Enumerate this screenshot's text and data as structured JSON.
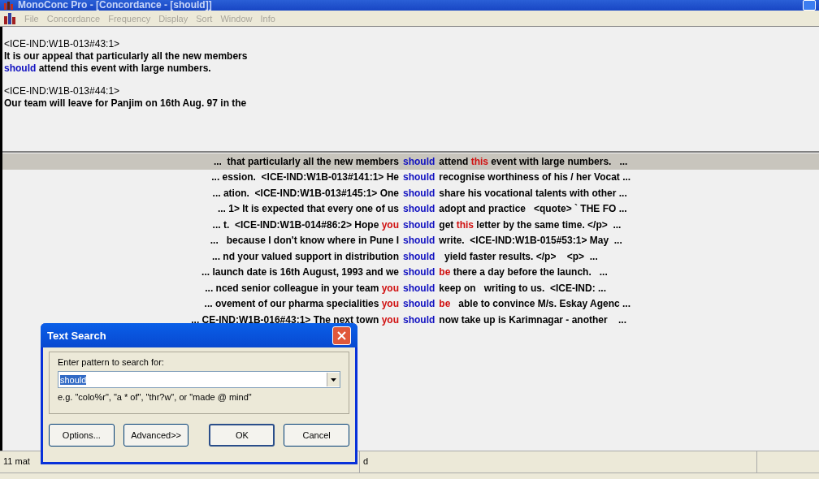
{
  "window": {
    "title": "MonoConc Pro - [Concordance - [should]]"
  },
  "menu": [
    "File",
    "Concordance",
    "Frequency",
    "Display",
    "Sort",
    "Window",
    "Info"
  ],
  "preview": [
    {
      "ref": "<ICE-IND:W1B-013#43:1>",
      "lines": [
        [
          {
            "text": "It is our appeal that particularly all the new members",
            "kind": "plain"
          }
        ],
        [
          {
            "text": "should",
            "kind": "node"
          },
          {
            "text": " attend this event with large numbers.",
            "kind": "plain"
          }
        ]
      ]
    },
    {
      "ref": "<ICE-IND:W1B-013#44:1>",
      "lines": [
        [
          {
            "text": "Our team will leave for Panjim on 16th Aug. 97 in the",
            "kind": "plain"
          }
        ]
      ]
    }
  ],
  "concordance": [
    {
      "selected": true,
      "left": [
        {
          "text": "...  that particularly all the new members",
          "kind": "plain"
        }
      ],
      "node": "should",
      "right": [
        {
          "text": "attend ",
          "kind": "plain"
        },
        {
          "text": "this",
          "kind": "collocate"
        },
        {
          "text": " event with large numbers.   ...",
          "kind": "plain"
        }
      ]
    },
    {
      "selected": false,
      "left": [
        {
          "text": "... ession.  <ICE-IND:W1B-013#141:1> He",
          "kind": "plain"
        }
      ],
      "node": "should",
      "right": [
        {
          "text": "recognise worthiness of his / her Vocat ...",
          "kind": "plain"
        }
      ]
    },
    {
      "selected": false,
      "left": [
        {
          "text": "... ation.  <ICE-IND:W1B-013#145:1> One",
          "kind": "plain"
        }
      ],
      "node": "should",
      "right": [
        {
          "text": "share his vocational talents with other ...",
          "kind": "plain"
        }
      ]
    },
    {
      "selected": false,
      "left": [
        {
          "text": "... 1> It is expected that every one of us",
          "kind": "plain"
        }
      ],
      "node": "should",
      "right": [
        {
          "text": "adopt and practice   <quote> ` THE FO ...",
          "kind": "plain"
        }
      ]
    },
    {
      "selected": false,
      "left": [
        {
          "text": "... t.  <ICE-IND:W1B-014#86:2> Hope ",
          "kind": "plain"
        },
        {
          "text": "you",
          "kind": "collocate"
        }
      ],
      "node": "should",
      "right": [
        {
          "text": "get ",
          "kind": "plain"
        },
        {
          "text": "this",
          "kind": "collocate"
        },
        {
          "text": " letter by the same time. </p>  ...",
          "kind": "plain"
        }
      ]
    },
    {
      "selected": false,
      "left": [
        {
          "text": "...   because I don't know where in Pune I",
          "kind": "plain"
        }
      ],
      "node": "should",
      "right": [
        {
          "text": "write.  <ICE-IND:W1B-015#53:1> May  ...",
          "kind": "plain"
        }
      ]
    },
    {
      "selected": false,
      "left": [
        {
          "text": "... nd your valued support in distribution",
          "kind": "plain"
        }
      ],
      "node": "should",
      "right": [
        {
          "text": "  yield faster results. </p>    <p>  ...",
          "kind": "plain"
        }
      ]
    },
    {
      "selected": false,
      "left": [
        {
          "text": "... launch date is 16th August, 1993 and we",
          "kind": "plain"
        }
      ],
      "node": "should",
      "right": [
        {
          "text": "be",
          "kind": "collocate"
        },
        {
          "text": " there a day before the launch.   ...",
          "kind": "plain"
        }
      ]
    },
    {
      "selected": false,
      "left": [
        {
          "text": "... nced senior colleague in your team ",
          "kind": "plain"
        },
        {
          "text": "you",
          "kind": "collocate"
        }
      ],
      "node": "should",
      "right": [
        {
          "text": "keep on   writing to us.  <ICE-IND: ...",
          "kind": "plain"
        }
      ]
    },
    {
      "selected": false,
      "left": [
        {
          "text": "... ovement of our pharma specialities ",
          "kind": "plain"
        },
        {
          "text": "you",
          "kind": "collocate"
        }
      ],
      "node": "should",
      "right": [
        {
          "text": "be",
          "kind": "collocate"
        },
        {
          "text": "   able to convince M/s. Eskay Agenc ...",
          "kind": "plain"
        }
      ]
    },
    {
      "selected": false,
      "left": [
        {
          "text": "... CE-IND:W1B-016#43:1> The next town ",
          "kind": "plain"
        },
        {
          "text": "you",
          "kind": "collocate"
        }
      ],
      "node": "should",
      "right": [
        {
          "text": "now take up is Karimnagar - another    ...",
          "kind": "plain"
        }
      ]
    }
  ],
  "status_bar": [
    "11 mat",
    "d"
  ],
  "dialog": {
    "title": "Text Search",
    "label": "Enter pattern to search for:",
    "value": "should",
    "hint": "e.g. \"colo%r\", \"a * of\", \"thr?w\", or \"made @ mind\"",
    "buttons": [
      {
        "label": "Options...",
        "default": false
      },
      {
        "label": "Advanced>>",
        "default": false
      },
      {
        "label": "OK",
        "default": true
      },
      {
        "label": "Cancel",
        "default": false
      }
    ]
  }
}
